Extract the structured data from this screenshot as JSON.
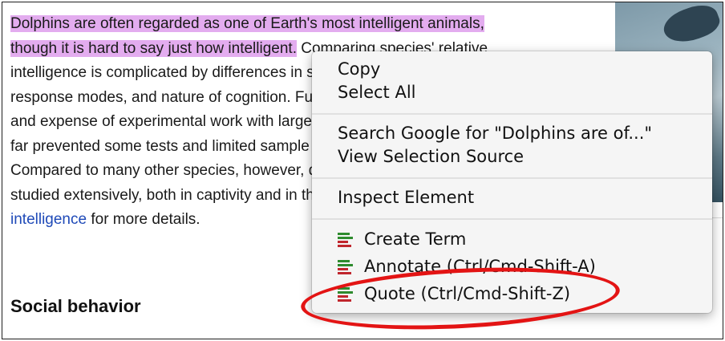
{
  "article": {
    "lines": [
      {
        "text": "Dolphins are often regarded as one of Earth's most intelligent animals,"
      },
      {
        "text": "though it is hard to say just how intelligent.",
        "rest": " Comparing species' relative"
      },
      {
        "text": "intelligence is complicated by differences in sensory apparatus,"
      },
      {
        "text": "response modes, and nature of cognition. Furthermore, the difficulty"
      },
      {
        "text": "and expense of experimental work with large aquatic animals has so"
      },
      {
        "text": "far prevented some tests and limited sample size and rigor in others."
      },
      {
        "text": "Compared to many other species, however, dolphin behavior has been"
      },
      {
        "text": "studied extensively, both in captivity and in the wild. See cetacean"
      },
      {
        "link": "intelligence",
        "text": " for more details."
      }
    ],
    "heading": "Social behavior"
  },
  "context_menu": {
    "group1": [
      "Copy",
      "Select All"
    ],
    "group2": [
      "Search Google for \"Dolphins are of...\"",
      "View Selection Source"
    ],
    "group3": [
      "Inspect Element"
    ],
    "extension_items": [
      "Create Term",
      "Annotate (Ctrl/Cmd-Shift-A)",
      "Quote (Ctrl/Cmd-Shift-Z)"
    ]
  },
  "colors": {
    "selection_highlight": "#e3acef",
    "link": "#1f4ab8",
    "annotation_ring": "#e31414"
  }
}
